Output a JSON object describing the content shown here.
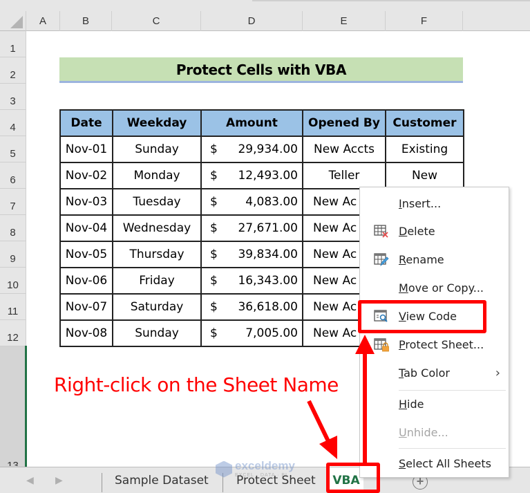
{
  "columns": [
    "A",
    "B",
    "C",
    "D",
    "E",
    "F"
  ],
  "rows": [
    "1",
    "2",
    "3",
    "4",
    "5",
    "6",
    "7",
    "8",
    "9",
    "10",
    "11",
    "12",
    "13"
  ],
  "title": "Protect Cells with VBA",
  "table": {
    "headers": [
      "Date",
      "Weekday",
      "Amount",
      "Opened By",
      "Customer"
    ],
    "currency_symbol": "$",
    "rows": [
      {
        "date": "Nov-01",
        "weekday": "Sunday",
        "amount": "29,934.00",
        "opened_by": "New Accts",
        "customer": "Existing"
      },
      {
        "date": "Nov-02",
        "weekday": "Monday",
        "amount": "12,493.00",
        "opened_by": "Teller",
        "customer": "New"
      },
      {
        "date": "Nov-03",
        "weekday": "Tuesday",
        "amount": "4,083.00",
        "opened_by": "New Ac",
        "customer": ""
      },
      {
        "date": "Nov-04",
        "weekday": "Wednesday",
        "amount": "27,671.00",
        "opened_by": "New Ac",
        "customer": ""
      },
      {
        "date": "Nov-05",
        "weekday": "Thursday",
        "amount": "39,834.00",
        "opened_by": "New Ac",
        "customer": ""
      },
      {
        "date": "Nov-06",
        "weekday": "Friday",
        "amount": "16,343.00",
        "opened_by": "New Ac",
        "customer": ""
      },
      {
        "date": "Nov-07",
        "weekday": "Saturday",
        "amount": "36,618.00",
        "opened_by": "New Ac",
        "customer": ""
      },
      {
        "date": "Nov-08",
        "weekday": "Sunday",
        "amount": "7,005.00",
        "opened_by": "New Ac",
        "customer": ""
      }
    ]
  },
  "annotation": "Right-click on the Sheet Name",
  "sheet_tabs": {
    "nav_prev": "◀",
    "nav_next": "▶",
    "tabs": [
      "Sample Dataset",
      "Protect Sheet",
      "VBA"
    ],
    "active_tab": "VBA",
    "add_sheet": "+"
  },
  "watermark": {
    "name": "exceldemy",
    "sub": "EXCEL · DATA · BI"
  },
  "context_menu": {
    "items": [
      {
        "key": "I",
        "rest": "nsert...",
        "icon": null,
        "disabled": false
      },
      {
        "key": "D",
        "rest": "elete",
        "icon": "delete-sheet-icon",
        "disabled": false
      },
      {
        "key": "R",
        "rest": "ename",
        "icon": "rename-sheet-icon",
        "disabled": false
      },
      {
        "key": "M",
        "rest": "ove or Copy...",
        "icon": null,
        "disabled": false
      },
      {
        "key": "V",
        "rest": "iew Code",
        "icon": "view-code-icon",
        "disabled": false
      },
      {
        "key": "P",
        "rest": "rotect Sheet...",
        "icon": "protect-sheet-icon",
        "disabled": false
      },
      {
        "key": "T",
        "rest": "ab Color",
        "icon": null,
        "disabled": false,
        "submenu": "›"
      },
      {
        "key": "H",
        "rest": "ide",
        "icon": null,
        "disabled": false
      },
      {
        "key": "U",
        "rest": "nhide...",
        "icon": null,
        "disabled": true
      },
      {
        "key": "S",
        "rest": "elect All Sheets",
        "icon": null,
        "disabled": false
      }
    ]
  },
  "colors": {
    "title_fill": "#c6e0b4",
    "header_fill": "#9bc2e6",
    "active_tab_text": "#217346",
    "highlight_red": "#ff0000"
  }
}
